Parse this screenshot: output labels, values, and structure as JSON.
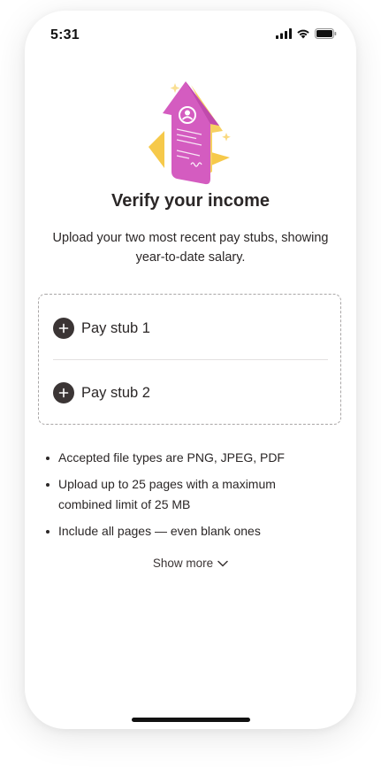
{
  "status_bar": {
    "time": "5:31"
  },
  "header": {
    "illustration_icon": "pay-stub-upload-illustration",
    "title": "Verify your income",
    "subtitle": "Upload your two most recent pay stubs, showing year-to-date salary."
  },
  "upload": {
    "items": [
      {
        "label": "Pay stub 1",
        "icon": "plus-icon"
      },
      {
        "label": "Pay stub 2",
        "icon": "plus-icon"
      }
    ]
  },
  "requirements": [
    "Accepted file types are PNG, JPEG, PDF",
    "Upload up to 25 pages with a maximum combined limit of 25 MB",
    "Include all pages — even blank ones"
  ],
  "show_more": {
    "label": "Show more",
    "icon": "chevron-down-icon"
  },
  "colors": {
    "text": "#2b2727",
    "icon_dark": "#3b3535",
    "illustration_pink": "#d45cc0",
    "illustration_yellow": "#f6c94a",
    "dashed_border": "#a9a6a6"
  }
}
